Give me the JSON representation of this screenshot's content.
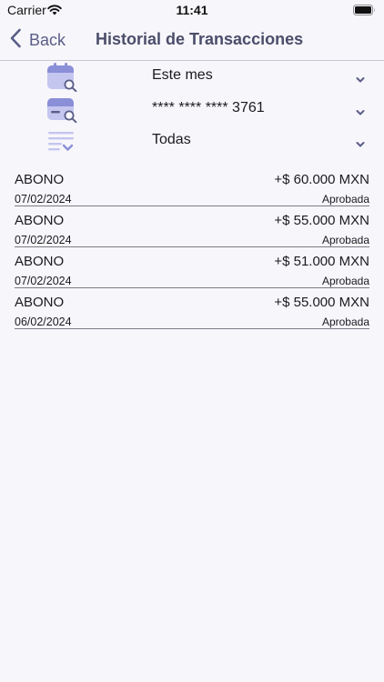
{
  "status_bar": {
    "carrier": "Carrier",
    "time": "11:41",
    "wifi_icon": "wifi-icon",
    "battery_icon": "battery-icon"
  },
  "nav": {
    "back_label": "Back",
    "title": "Historial de Transacciones",
    "back_icon": "chevron-left-icon"
  },
  "filters": [
    {
      "icon": "calendar-search-icon",
      "value": "Este mes"
    },
    {
      "icon": "card-search-icon",
      "value": "**** **** **** 3761"
    },
    {
      "icon": "list-filter-icon",
      "value": "Todas"
    }
  ],
  "transactions": [
    {
      "type": "ABONO",
      "amount": "+$ 60.000 MXN",
      "date": "07/02/2024",
      "status": "Aprobada"
    },
    {
      "type": "ABONO",
      "amount": "+$ 55.000 MXN",
      "date": "07/02/2024",
      "status": "Aprobada"
    },
    {
      "type": "ABONO",
      "amount": "+$ 51.000 MXN",
      "date": "07/02/2024",
      "status": "Aprobada"
    },
    {
      "type": "ABONO",
      "amount": "+$ 55.000 MXN",
      "date": "06/02/2024",
      "status": "Aprobada"
    }
  ],
  "colors": {
    "accent": "#5a5e86",
    "icon_primary": "#8a8fd8",
    "icon_light": "#c4c6ef",
    "background": "#f7f6fb"
  }
}
